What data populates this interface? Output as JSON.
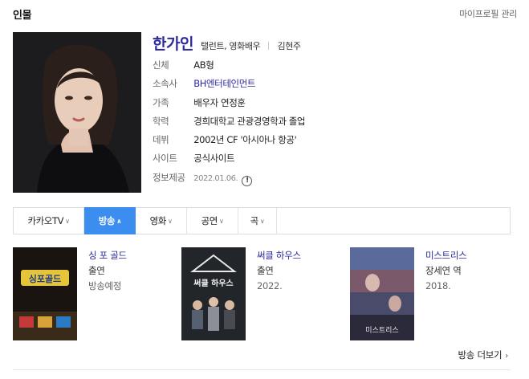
{
  "header": {
    "title": "인물",
    "manage_link": "마이프로필 관리"
  },
  "profile": {
    "name": "한가인",
    "occupation": "탤런트, 영화배우",
    "original_name": "김현주",
    "fields": [
      {
        "label": "신체",
        "value": "AB형",
        "link": false
      },
      {
        "label": "소속사",
        "value": "BH엔터테인먼트",
        "link": true
      },
      {
        "label": "가족",
        "value": "배우자 연정훈",
        "link": false
      },
      {
        "label": "학력",
        "value": "경희대학교 관광경영학과 졸업",
        "link": false
      },
      {
        "label": "데뷔",
        "value": "2002년 CF '아시아나 항공'",
        "link": false
      },
      {
        "label": "사이트",
        "value": "공식사이트",
        "link": false
      }
    ],
    "info_provided": {
      "label": "정보제공",
      "date": "2022.01.06.",
      "icon": "!"
    }
  },
  "tabs": [
    {
      "label": "카카오TV",
      "chevron": "∨",
      "active": false
    },
    {
      "label": "방송",
      "chevron": "∧",
      "active": true
    },
    {
      "label": "영화",
      "chevron": "∨",
      "active": false
    },
    {
      "label": "공연",
      "chevron": "∨",
      "active": false
    },
    {
      "label": "곡",
      "chevron": "∨",
      "active": false
    }
  ],
  "works": [
    {
      "title": "싱 포 골드",
      "role": "출연",
      "status": "방송예정",
      "poster_text": "싱포골드"
    },
    {
      "title": "써클 하우스",
      "role": "출연",
      "status": "2022.",
      "poster_text": "써클 하우스"
    },
    {
      "title": "미스트리스",
      "role": "장세연 역",
      "status": "2018.",
      "poster_text": "미스트리스"
    }
  ],
  "more_link": {
    "label": "방송 더보기",
    "arrow": "›"
  },
  "colors": {
    "accent_link": "#2e2a9e",
    "active_tab": "#3b8df0"
  }
}
